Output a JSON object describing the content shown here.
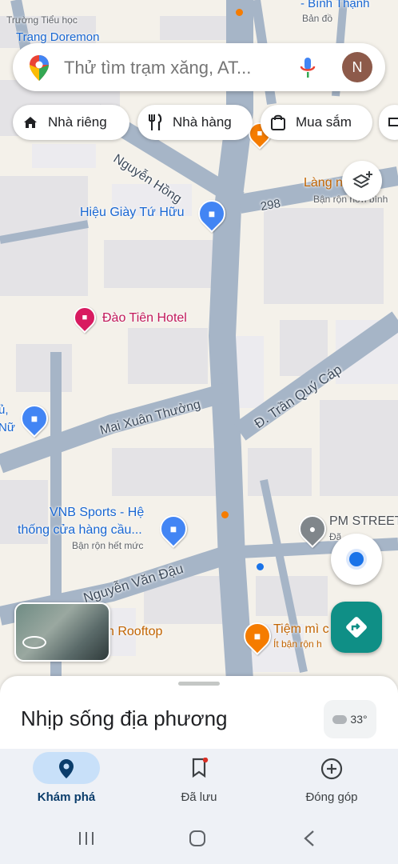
{
  "status": {
    "top_left_label": "Trang Doremon",
    "top_left_small": "Trường Tiểu học",
    "top_right_label": "- Bình Thạnh",
    "top_right_small": "Bản đồ"
  },
  "search": {
    "placeholder": "Thử tìm trạm xăng, AT...",
    "avatar_letter": "N"
  },
  "chips": [
    {
      "label": "Nhà riêng",
      "icon": "home-icon"
    },
    {
      "label": "Nhà hàng",
      "icon": "restaurant-icon"
    },
    {
      "label": "Mua sắm",
      "icon": "shopping-bag-icon"
    }
  ],
  "map": {
    "streets": {
      "nguyen_hong": "Nguyễn Hồng",
      "mai_xuan_thuong": "Mai Xuân Thưởng",
      "tran_quy_cap": "Đ. Trần Quý Cáp",
      "nguyen_van_dau": "Nguyễn Văn Đậu",
      "route_298": "298"
    },
    "pois": {
      "hieu_giay": "Hiệu Giày Tứ Hữu",
      "dao_tien": "Đào Tiên Hotel",
      "vnb_line1": "VNB Sports - Hệ",
      "vnb_line2": "thống cửa hàng cầu...",
      "vnb_status": "Bận rộn hết mức",
      "lang_name": "Làng n   Na",
      "lang_status": "Bận rộn hơn bình",
      "pm_street": "PM STREET",
      "pm_small": "Đã",
      "rooftop": "n Rooftop",
      "tiem_mi": "Tiệm mì c      Ớt",
      "tiem_status": "Ít bận rộn h",
      "left_edge_name": "ủ,",
      "left_edge_name2": "Nữ"
    }
  },
  "sheet": {
    "title": "Nhịp sống địa phương",
    "weather": "33°"
  },
  "bottom_nav": [
    {
      "label": "Khám phá",
      "icon": "explore-pin-icon",
      "active": true
    },
    {
      "label": "Đã lưu",
      "icon": "bookmark-icon",
      "active": false
    },
    {
      "label": "Đóng góp",
      "icon": "add-circle-icon",
      "active": false
    }
  ],
  "colors": {
    "water_road": "#a6b5c7",
    "accent_blue": "#1a73e8",
    "active_nav_bg": "#c8e0f9",
    "direction_fab": "#0f8f86"
  }
}
